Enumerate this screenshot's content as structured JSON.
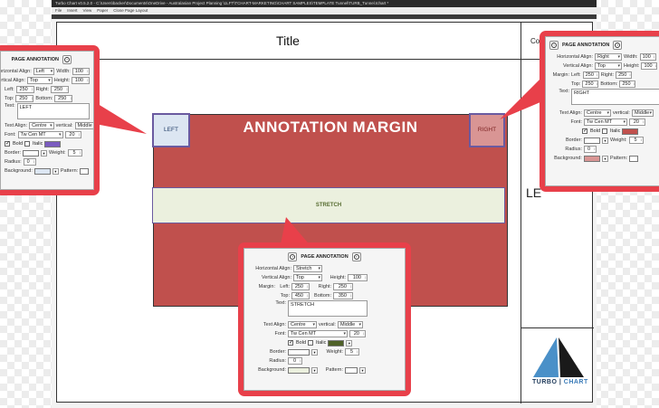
{
  "app": {
    "title": "Turbo Chart v0.5.2.0 - C:\\Users\\backer\\Documents\\OneDrive - Australasian Project Planning \\1LFT\\TCHART-MARKETING\\CHART SAMPLES\\TEMPLATE Tunnel\\TURB_Tunnel.tchart *",
    "menu": [
      "File",
      "Insert",
      "View",
      "Paper",
      "Close Page Layout"
    ]
  },
  "page": {
    "title": "Title",
    "co_text": "Co",
    "le_text": "LE",
    "chart_title": "ANNOTATION MARGIN",
    "stretch_label": "STRETCH",
    "left_label": "LEFT",
    "right_label": "RIGHT",
    "logo": {
      "word1": "TURBO",
      "sep": "|",
      "word2": "CHART"
    },
    "colors": {
      "chart_fill": "#c0504d",
      "stretch_fill": "#ebf0de",
      "left_fill": "#dce6f2",
      "right_fill": "#d99594",
      "callout": "#e8404a"
    }
  },
  "panel_labels": {
    "heading": "PAGE ANNOTATION",
    "h_align": "Horizontal Align:",
    "v_align": "Vertical Align:",
    "width": "Width:",
    "height": "Height:",
    "margin": "Margin:",
    "left": "Left:",
    "right": "Right:",
    "top": "Top:",
    "bottom": "Bottom:",
    "text": "Text:",
    "text_align": "Text Align:",
    "vertical": "vertical:",
    "font": "Font:",
    "bold": "Bold",
    "italic": "Italic",
    "border": "Border:",
    "weight": "Weight:",
    "radius": "Radius:",
    "background": "Background:",
    "pattern": "Pattern:"
  },
  "panel_left": {
    "h_align": "Left",
    "v_align": "Top",
    "width": "100",
    "height": "100",
    "left": "250",
    "right": "250",
    "top": "250",
    "bottom": "250",
    "text": "LEFT",
    "text_align": "Centre",
    "vertical": "Middle",
    "font": "Tw Cen MT",
    "font_size": "20",
    "weight": "5",
    "radius": "0",
    "text_color": "#7b5cc0",
    "background_color": "#dce6f2"
  },
  "panel_right": {
    "h_align": "Right",
    "v_align": "Top",
    "width": "100",
    "height": "100",
    "left": "250",
    "right": "250",
    "top": "250",
    "bottom": "250",
    "text": "RIGHT",
    "text_align": "Centre",
    "vertical": "Middle",
    "font": "Tw Cen MT",
    "font_size": "20",
    "weight": "5",
    "radius": "0",
    "text_color": "#c0504d",
    "background_color": "#d99594"
  },
  "panel_bottom": {
    "h_align": "Stretch",
    "v_align": "Top",
    "height": "100",
    "left": "250",
    "right": "250",
    "top": "450",
    "bottom": "350",
    "text": "STRETCH",
    "text_align": "Centre",
    "vertical": "Middle",
    "font": "Tw Cen MT",
    "font_size": "20",
    "weight": "5",
    "radius": "0",
    "text_color": "#4f6228",
    "background_color": "#ebf0de"
  }
}
